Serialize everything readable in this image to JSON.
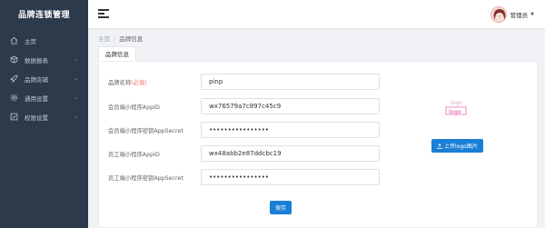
{
  "app": {
    "title": "品牌连锁管理"
  },
  "sidebar": {
    "items": [
      {
        "label": "主页",
        "icon": "home-icon",
        "has_children": false
      },
      {
        "label": "数据报表",
        "icon": "box-icon",
        "has_children": true
      },
      {
        "label": "品牌店铺",
        "icon": "rocket-icon",
        "has_children": true
      },
      {
        "label": "通用设置",
        "icon": "gear-icon",
        "has_children": true
      },
      {
        "label": "权限设置",
        "icon": "checkbox-icon",
        "has_children": true
      }
    ]
  },
  "header": {
    "username": "管理员"
  },
  "breadcrumb": {
    "home": "主页",
    "separator": "/",
    "current": "品牌信息"
  },
  "tab": {
    "label": "品牌信息"
  },
  "form": {
    "fields": [
      {
        "label": "品牌名称",
        "required_text": "(必填)",
        "value": "pinp"
      },
      {
        "label": "会员端小程序AppID",
        "value": "wx76579a7c897c45c9"
      },
      {
        "label": "会员端小程序密钥AppSecret",
        "value": "••••••••••••••••"
      },
      {
        "label": "员工端小程序AppID",
        "value": "wx48abb2e87ddcbc19"
      },
      {
        "label": "员工端小程序密钥AppSecret",
        "value": "••••••••••••••••"
      }
    ],
    "logo_text_top": "logo",
    "logo_text_bottom": "logo",
    "upload_label": "上传logo图片",
    "save_label": "保存"
  },
  "colors": {
    "sidebar_bg": "#2d3a4b",
    "primary": "#1a7fd6",
    "required": "#f56c6c",
    "logo_pink": "#d9469b"
  }
}
